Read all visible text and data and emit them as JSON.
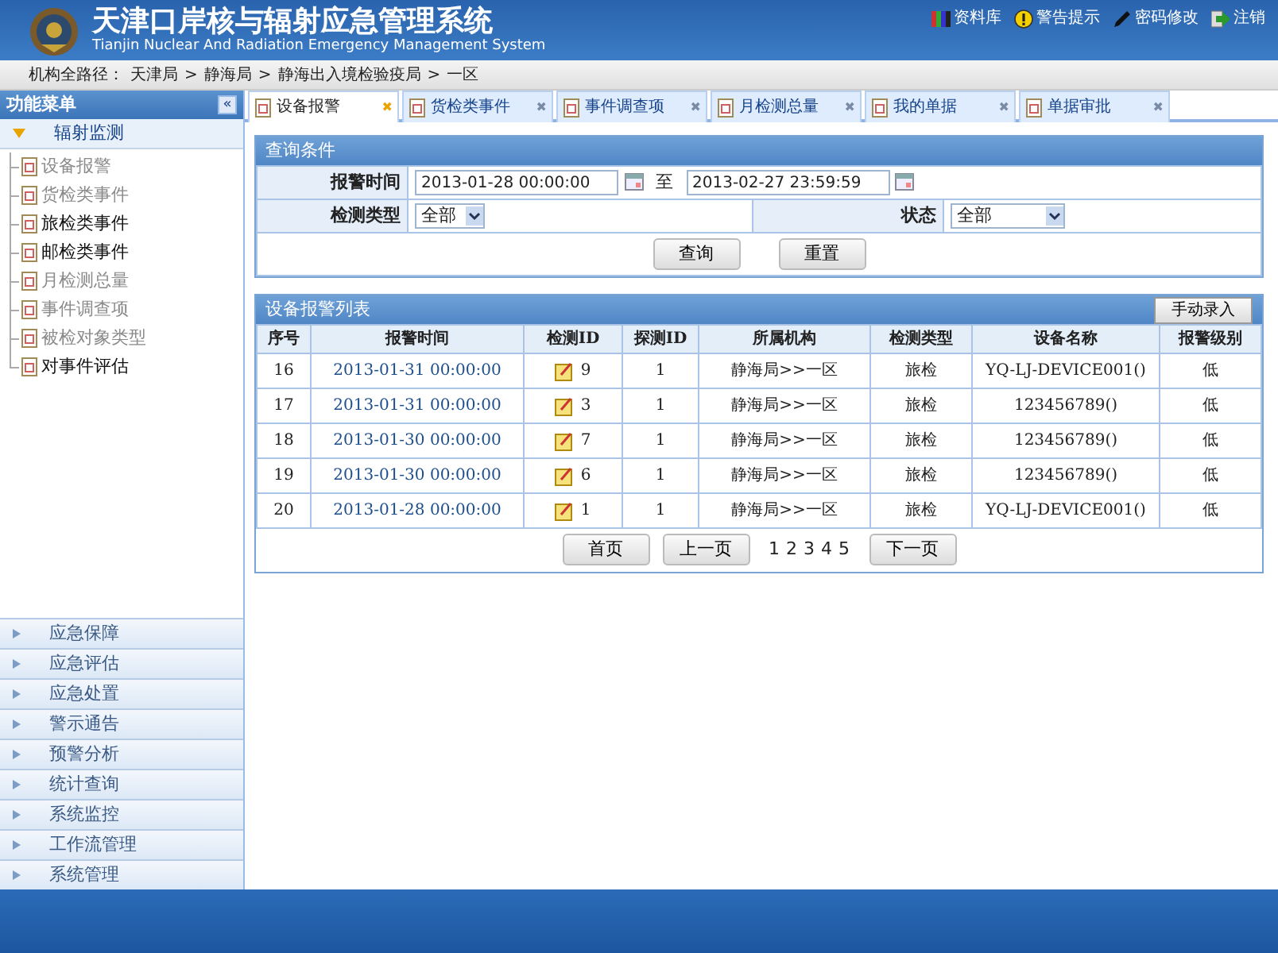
{
  "header": {
    "title": "天津口岸核与辐射应急管理系统",
    "subtitle": "Tianjin Nuclear And Radiation Emergency Management System",
    "links": [
      {
        "kind": "library",
        "label": "资料库"
      },
      {
        "kind": "warning",
        "label": "警告提示"
      },
      {
        "kind": "pen",
        "label": "密码修改"
      },
      {
        "kind": "logout",
        "label": "注销"
      }
    ]
  },
  "breadcrumb": {
    "label": "机构全路径：",
    "items": [
      "天津局",
      "静海局",
      "静海出入境检验疫局",
      "一区"
    ],
    "separator": ">"
  },
  "sidebar": {
    "title": "功能菜单",
    "collapse": "«",
    "section": {
      "label": "辐射监测",
      "expanded": true,
      "items": [
        {
          "label": "设备报警",
          "disabled": true
        },
        {
          "label": "货检类事件",
          "disabled": true
        },
        {
          "label": "旅检类事件",
          "disabled": false
        },
        {
          "label": "邮检类事件",
          "disabled": false
        },
        {
          "label": "月检测总量",
          "disabled": true
        },
        {
          "label": "事件调查项",
          "disabled": true
        },
        {
          "label": "被检对象类型",
          "disabled": true
        },
        {
          "label": "对事件评估",
          "disabled": false
        }
      ]
    },
    "groups": [
      {
        "label": "应急保障",
        "expanded": false
      },
      {
        "label": "应急评估",
        "expanded": false
      },
      {
        "label": "应急处置",
        "expanded": false
      },
      {
        "label": "警示通告",
        "expanded": false
      },
      {
        "label": "预警分析",
        "expanded": false
      },
      {
        "label": "统计查询",
        "expanded": false
      },
      {
        "label": "系统监控",
        "expanded": false
      },
      {
        "label": "工作流管理",
        "expanded": false
      },
      {
        "label": "系统管理",
        "expanded": false
      }
    ]
  },
  "tabs": [
    {
      "label": "设备报警",
      "selected": true,
      "close": "✖"
    },
    {
      "label": "货检类事件",
      "selected": false,
      "close": "✖"
    },
    {
      "label": "事件调查项",
      "selected": false,
      "close": "✖"
    },
    {
      "label": "月检测总量",
      "selected": false,
      "close": "✖"
    },
    {
      "label": "我的单据",
      "selected": false,
      "close": "✖"
    },
    {
      "label": "单据审批",
      "selected": false,
      "close": "✖"
    }
  ],
  "query": {
    "title": "查询条件",
    "time_label": "报警时间",
    "start": "2013-01-28 00:00:00",
    "to": "至",
    "end": "2013-02-27 23:59:59",
    "type_label": "检测类型",
    "type_value": "全部",
    "status_label": "状态",
    "status_value": "全部",
    "buttons": [
      "查询",
      "重置"
    ]
  },
  "table": {
    "title": "设备报警列表",
    "action": "手动录入",
    "columns": [
      "序号",
      "报警时间",
      "检测ID",
      "探测ID",
      "所属机构",
      "检测类型",
      "设备名称",
      "报警级别"
    ],
    "rows": [
      [
        "16",
        "2013-01-31 00:00:00",
        "9",
        "1",
        "静海局>>一区",
        "旅检",
        "YQ-LJ-DEVICE001()",
        "低"
      ],
      [
        "17",
        "2013-01-31 00:00:00",
        "3",
        "1",
        "静海局>>一区",
        "旅检",
        "123456789()",
        "低"
      ],
      [
        "18",
        "2013-01-30 00:00:00",
        "7",
        "1",
        "静海局>>一区",
        "旅检",
        "123456789()",
        "低"
      ],
      [
        "19",
        "2013-01-30 00:00:00",
        "6",
        "1",
        "静海局>>一区",
        "旅检",
        "123456789()",
        "低"
      ],
      [
        "20",
        "2013-01-28 00:00:00",
        "1",
        "1",
        "静海局>>一区",
        "旅检",
        "YQ-LJ-DEVICE001()",
        "低"
      ]
    ]
  },
  "pager": {
    "first": "首页",
    "prev": "上一页",
    "pages": [
      "1",
      "2",
      "3",
      "4",
      "5"
    ],
    "next": "下一页"
  }
}
